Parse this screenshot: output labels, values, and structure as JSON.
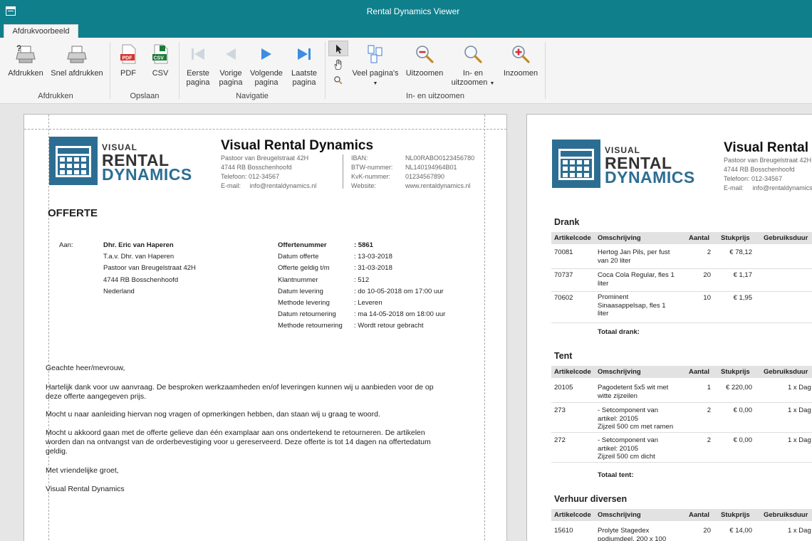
{
  "window": {
    "title": "Rental Dynamics Viewer"
  },
  "tabs": [
    {
      "label": "Afdrukvoorbeeld"
    }
  ],
  "ribbon": {
    "groups": {
      "print": "Afdrukken",
      "save": "Opslaan",
      "nav": "Navigatie",
      "zoom": "In- en uitzoomen"
    },
    "buttons": {
      "print": "Afdrukken",
      "quick_print": "Snel afdrukken",
      "pdf": "PDF",
      "csv": "CSV",
      "first_l1": "Eerste",
      "first_l2": "pagina",
      "prev_l1": "Vorige",
      "prev_l2": "pagina",
      "next_l1": "Volgende",
      "next_l2": "pagina",
      "last_l1": "Laatste",
      "last_l2": "pagina",
      "many_pages_l1": "Veel pagina's",
      "zoom_out": "Uitzoomen",
      "zoom_l1": "In- en",
      "zoom_l2": "uitzoomen",
      "zoom_in": "Inzoomen"
    },
    "badges": {
      "pdf": "PDF",
      "csv": "CSV"
    }
  },
  "logo": {
    "line1": "VISUAL",
    "line2": "RENTAL",
    "line3": "DYNAMICS"
  },
  "company": {
    "name": "Visual Rental Dynamics",
    "street": "Pastoor van Breugelstraat 42H",
    "city": "4744 RB Bosschenhoofd",
    "phone": "Telefoon:  012-34567",
    "email_label": "E-mail:",
    "email": "info@rentaldynamics.nl",
    "iban_label": "IBAN:",
    "iban": "NL00RABO0123456780",
    "btw_label": "BTW-nummer:",
    "btw": "NL140194964B01",
    "kvk_label": "KvK-nummer:",
    "kvk": "01234567890",
    "web_label": "Website:",
    "web": "www.rentaldynamics.nl"
  },
  "page2_company": {
    "name": "Visual Rental",
    "street": "Pastoor van Breugelstraat 42H",
    "city": "4744 RB Bosschenhoofd",
    "phone": "Telefoon:  012-34567",
    "email_label": "E-mail:",
    "email": "info@rentaldynamics.nl"
  },
  "offer": {
    "title": "OFFERTE",
    "to_label": "Aan:",
    "to": [
      "Dhr. Eric van Haperen",
      "T.a.v. Dhr. van Haperen",
      "Pastoor van Breugelstraat 42H",
      "4744 RB Bosschenhoofd",
      "Nederland"
    ],
    "fields": [
      {
        "label": "Offertenummer",
        "value": ": 5861"
      },
      {
        "label": "Datum offerte",
        "value": ": 13-03-2018"
      },
      {
        "label": "Offerte geldig t/m",
        "value": ": 31-03-2018"
      },
      {
        "label": "Klantnummer",
        "value": ": 512"
      },
      {
        "label": "Datum levering",
        "value": ": do 10-05-2018 om 17:00 uur"
      },
      {
        "label": "Methode levering",
        "value": ": Leveren"
      },
      {
        "label": "Datum retournering",
        "value": ": ma 14-05-2018 om 18:00 uur"
      },
      {
        "label": "Methode retournering",
        "value": ": Wordt retour gebracht"
      }
    ],
    "greeting": "Geachte heer/mevrouw,",
    "p1a": "Hartelijk dank voor uw aanvraag. De besproken werkzaamheden en/of leveringen kunnen wij u aanbieden voor de op",
    "p1b": "deze offerte aangegeven prijs.",
    "p2": "Mocht u naar aanleiding hiervan nog vragen of opmerkingen hebben,  dan staan wij u graag te woord.",
    "p3a": "Mocht u akkoord gaan met de offerte gelieve dan één examplaar aan ons ondertekend te retourneren. De artikelen",
    "p3b": "worden dan na ontvangst van de orderbevestiging voor u gereserveerd. Deze  offerte is tot 14 dagen na offertedatum",
    "p3c": "geldig.",
    "closing": "Met vriendelijke groet,",
    "signature": "Visual Rental Dynamics"
  },
  "columns": [
    "Artikelcode",
    "Omschrijving",
    "Aantal",
    "Stukprijs",
    "Gebruiksduur"
  ],
  "sections": [
    {
      "title": "Drank",
      "rows": [
        {
          "code": "70081",
          "desc1": "Hertog Jan Pils, per fust",
          "desc2": "van 20 liter",
          "desc3": "",
          "qty": "2",
          "price": "€ 78,12",
          "dur": ""
        },
        {
          "code": "70737",
          "desc1": "Coca Cola Regular, fles 1",
          "desc2": "liter",
          "desc3": "",
          "qty": "20",
          "price": "€ 1,17",
          "dur": ""
        },
        {
          "code": "70602",
          "desc1": "Prominent",
          "desc2": "Sinaasappelsap, fles 1",
          "desc3": "liter",
          "qty": "10",
          "price": "€ 1,95",
          "dur": ""
        }
      ],
      "total": "Totaal drank:"
    },
    {
      "title": "Tent",
      "rows": [
        {
          "code": "20105",
          "desc1": "Pagodetent 5x5 wit met",
          "desc2": "witte zijzeilen",
          "desc3": "",
          "qty": "1",
          "price": "€ 220,00",
          "dur": "1 x Dag"
        },
        {
          "code": "273",
          "desc1": "- Setcomponent van",
          "desc2": "artikel: 20105",
          "desc3": "Zijzeil 500 cm met ramen",
          "qty": "2",
          "price": "€ 0,00",
          "dur": "1 x Dag"
        },
        {
          "code": "272",
          "desc1": "- Setcomponent van",
          "desc2": "artikel: 20105",
          "desc3": "Zijzeil 500 cm dicht",
          "qty": "2",
          "price": "€ 0,00",
          "dur": "1 x Dag"
        }
      ],
      "total": "Totaal tent:"
    },
    {
      "title": "Verhuur diversen",
      "rows": [
        {
          "code": "15610",
          "desc1": "Prolyte Stagedex",
          "desc2": "podiumdeel, 200 x 100",
          "desc3": "",
          "qty": "20",
          "price": "€ 14,00",
          "dur": "1 x Dag"
        }
      ],
      "total": ""
    }
  ]
}
